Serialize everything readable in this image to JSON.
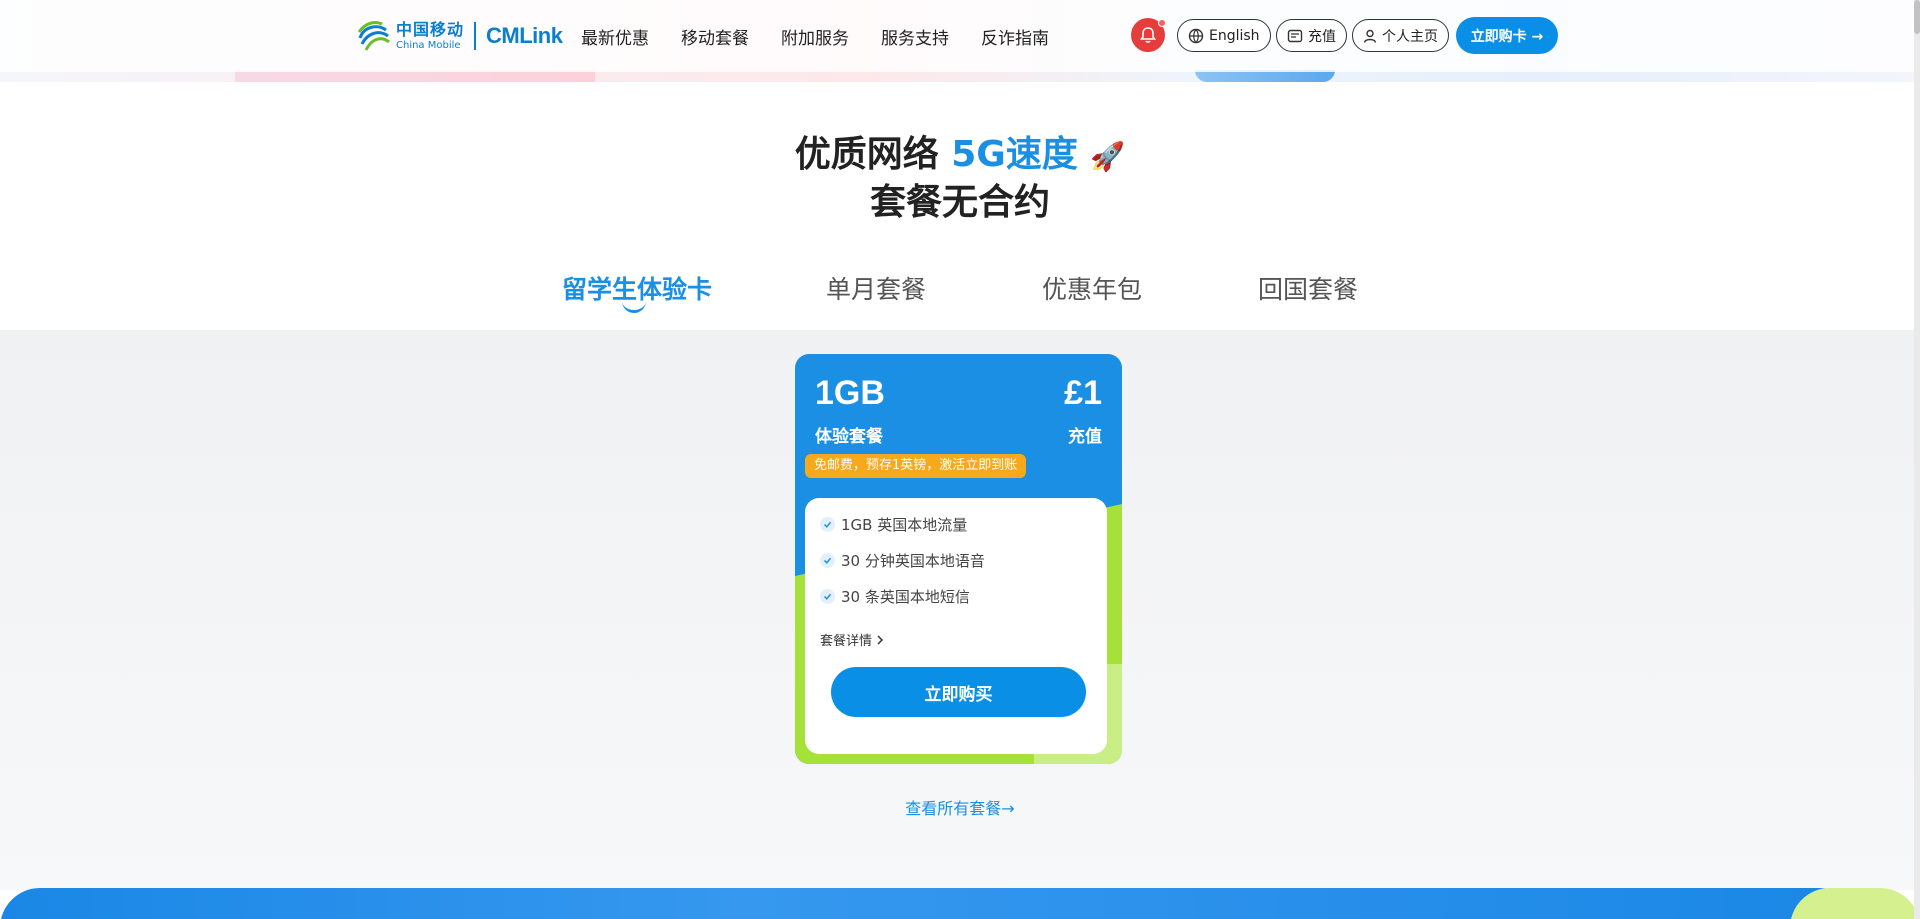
{
  "brand": {
    "logo_cn": "中国移动",
    "logo_en": "China Mobile",
    "logo_product": "CMLink"
  },
  "nav": {
    "items": [
      "最新优惠",
      "移动套餐",
      "附加服务",
      "服务支持",
      "反诈指南"
    ]
  },
  "header_actions": {
    "language_label": "English",
    "recharge_label": "充值",
    "profile_label": "个人主页",
    "buy_card_label": "立即购卡 →",
    "icons": [
      "bell-icon",
      "globe-icon",
      "recharge-icon",
      "user-icon",
      "arrow-right-icon"
    ]
  },
  "headline": {
    "line1_prefix": "优质网络 ",
    "line1_highlight": "5G速度",
    "line1_emoji": "🚀",
    "line2": "套餐无合约"
  },
  "tabs": {
    "items": [
      "留学生体验卡",
      "单月套餐",
      "优惠年包",
      "回国套餐"
    ],
    "active_index": 0
  },
  "plan_card": {
    "data": "1GB",
    "plan_name": "体验套餐",
    "price": "£1",
    "price_unit": "充值",
    "badge": "免邮费，预存1英镑，激活立即到账",
    "features": [
      "1GB 英国本地流量",
      "30 分钟英国本地语音",
      "30 条英国本地短信"
    ],
    "details_label": "套餐详情",
    "buy_label": "立即购买"
  },
  "view_all_label": "查看所有套餐→",
  "colors": {
    "primary": "#1a8fe3",
    "button": "#0a8fe6",
    "green": "#a6e13a",
    "badge": "#f7a81b",
    "bell": "#e53c3c"
  }
}
